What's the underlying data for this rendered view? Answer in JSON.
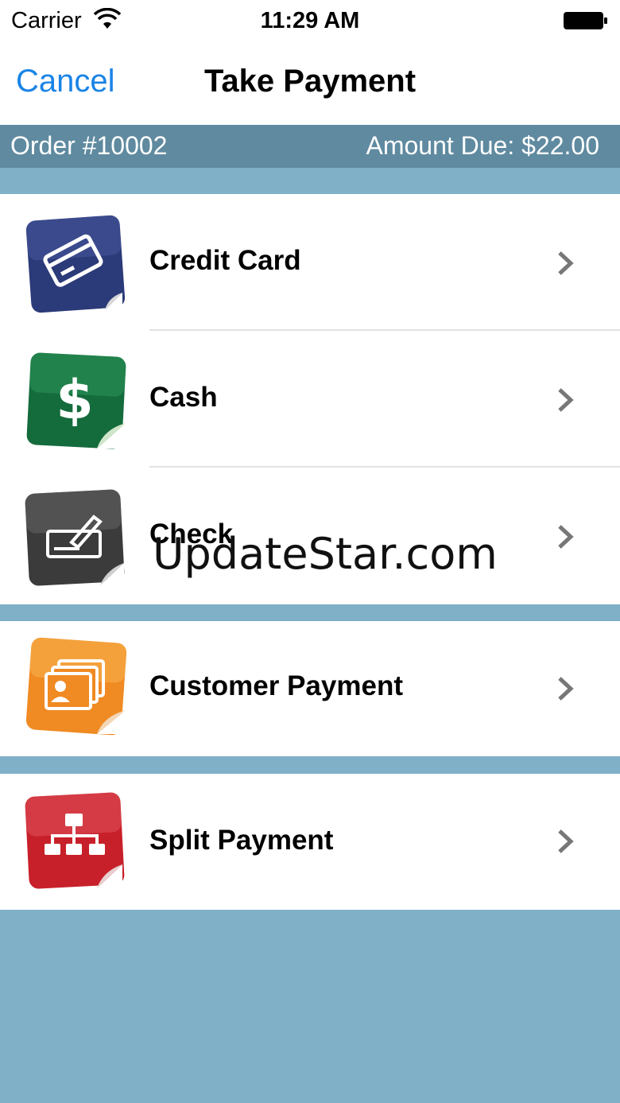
{
  "status_bar": {
    "carrier": "Carrier",
    "time": "11:29 AM"
  },
  "nav": {
    "cancel": "Cancel",
    "title": "Take Payment"
  },
  "order": {
    "number": "Order #10002",
    "amount_due": "Amount Due: $22.00"
  },
  "groups": [
    {
      "items": [
        {
          "label": "Credit Card",
          "icon": "credit-card-icon",
          "color": "#2b3a78"
        },
        {
          "label": "Cash",
          "icon": "cash-icon",
          "color": "#146b3c"
        },
        {
          "label": "Check",
          "icon": "check-icon",
          "color": "#3b3b3b"
        }
      ]
    },
    {
      "items": [
        {
          "label": "Customer Payment",
          "icon": "customer-payment-icon",
          "color": "#f08a22"
        }
      ]
    },
    {
      "items": [
        {
          "label": "Split Payment",
          "icon": "split-payment-icon",
          "color": "#c8202a"
        }
      ]
    }
  ],
  "watermark": "UpdateStar.com",
  "colors": {
    "background": "#7fb0c8",
    "order_bar": "#5f8aa0",
    "link": "#1a84e6"
  }
}
